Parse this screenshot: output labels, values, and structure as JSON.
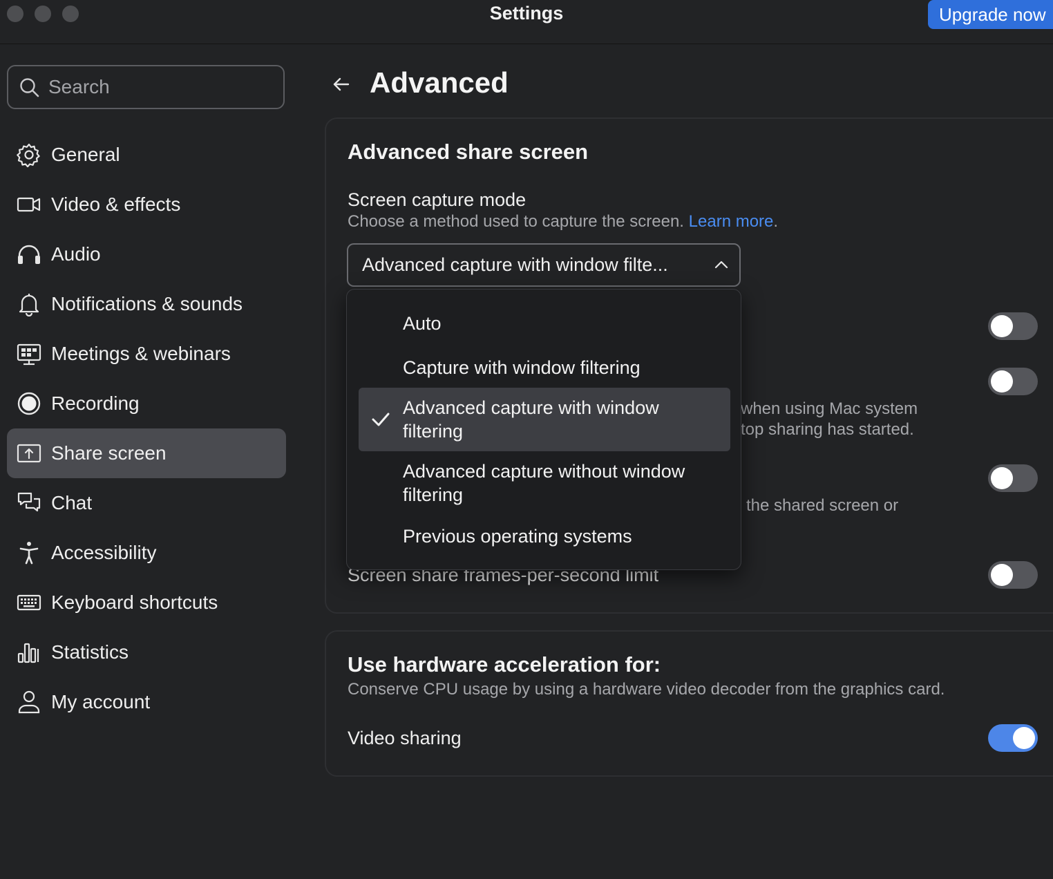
{
  "window": {
    "title": "Settings",
    "upgrade_label": "Upgrade now"
  },
  "sidebar": {
    "search_placeholder": "Search",
    "items": [
      {
        "label": "General",
        "icon": "gear-icon"
      },
      {
        "label": "Video & effects",
        "icon": "video-camera-icon"
      },
      {
        "label": "Audio",
        "icon": "headphones-icon"
      },
      {
        "label": "Notifications & sounds",
        "icon": "bell-icon"
      },
      {
        "label": "Meetings & webinars",
        "icon": "meetings-icon"
      },
      {
        "label": "Recording",
        "icon": "record-icon"
      },
      {
        "label": "Share screen",
        "icon": "share-screen-icon",
        "active": true
      },
      {
        "label": "Chat",
        "icon": "chat-icon"
      },
      {
        "label": "Accessibility",
        "icon": "accessibility-icon"
      },
      {
        "label": "Keyboard shortcuts",
        "icon": "keyboard-icon"
      },
      {
        "label": "Statistics",
        "icon": "statistics-icon"
      },
      {
        "label": "My account",
        "icon": "user-icon"
      }
    ]
  },
  "main": {
    "page_title": "Advanced",
    "share_section": {
      "title": "Advanced share screen",
      "capture_mode_label": "Screen capture mode",
      "capture_mode_desc": "Choose a method used to capture the screen.",
      "learn_more": "Learn more",
      "period": ".",
      "selected_value": "Advanced capture with window filte...",
      "partial_desc_1a": "when using Mac system",
      "partial_desc_1b": "top sharing has started.",
      "partial_desc_2": "the shared screen or",
      "fps_label": "Screen share frames-per-second limit",
      "toggles": [
        false,
        false,
        false,
        false
      ]
    },
    "dropdown": {
      "options": [
        {
          "label": "Auto",
          "selected": false
        },
        {
          "label": "Capture with window filtering",
          "selected": false
        },
        {
          "label_line1": "Advanced capture with window",
          "label_line2": "filtering",
          "selected": true
        },
        {
          "label_line1": "Advanced capture without window",
          "label_line2": "filtering",
          "selected": false
        },
        {
          "label": "Previous operating systems",
          "selected": false
        }
      ]
    },
    "hw_section": {
      "title": "Use hardware acceleration for:",
      "desc": "Conserve CPU usage by using a hardware video decoder from the graphics card.",
      "video_sharing_label": "Video sharing",
      "video_sharing_on": true
    }
  },
  "colors": {
    "accent": "#2f6fdb",
    "toggle_on": "#4d86e8",
    "link": "#4a8df2",
    "background": "#222325"
  }
}
